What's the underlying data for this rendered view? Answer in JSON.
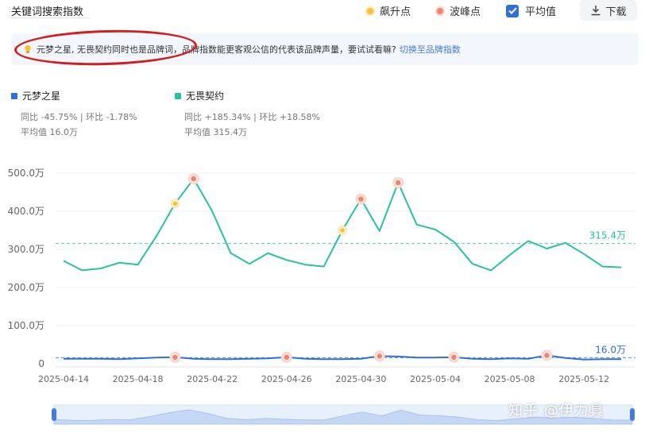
{
  "header": {
    "title": "关键词搜索指数",
    "legend_rise": "飙升点",
    "legend_peak": "波峰点",
    "avg_checkbox_label": "平均值",
    "download_label": "下载"
  },
  "notice": {
    "text": "元梦之星, 无畏契约同时也是品牌词，品牌指数能更客观公信的代表该品牌声量，要试试看嘛?",
    "link": "切换至品牌指数"
  },
  "series_info": [
    {
      "name": "元梦之星",
      "yoy": "同比 -45.75% | 环比 -1.78%",
      "avg": "平均值 16.0万",
      "color": "#2f6fd6"
    },
    {
      "name": "无畏契约",
      "yoy": "同比 +185.34% | 环比 +18.58%",
      "avg": "平均值 315.4万",
      "color": "#28c2a0"
    }
  ],
  "colors": {
    "series1": "#2f6fd6",
    "series2": "#28c2a0",
    "rise": "#f6c33e",
    "peak": "#f2826b",
    "accent": "#2f6fd6"
  },
  "watermark": "知乎 @伊力具",
  "chart_data": {
    "type": "line",
    "x": [
      "2025-04-14",
      "2025-04-15",
      "2025-04-16",
      "2025-04-17",
      "2025-04-18",
      "2025-04-19",
      "2025-04-20",
      "2025-04-21",
      "2025-04-22",
      "2025-04-23",
      "2025-04-24",
      "2025-04-25",
      "2025-04-26",
      "2025-04-27",
      "2025-04-28",
      "2025-04-29",
      "2025-04-30",
      "2025-05-01",
      "2025-05-02",
      "2025-05-03",
      "2025-05-04",
      "2025-05-05",
      "2025-05-06",
      "2025-05-07",
      "2025-05-08",
      "2025-05-09",
      "2025-05-10",
      "2025-05-11",
      "2025-05-12",
      "2025-05-13",
      "2025-05-14"
    ],
    "x_ticks": [
      "2025-04-14",
      "2025-04-18",
      "2025-04-22",
      "2025-04-26",
      "2025-04-30",
      "2025-05-04",
      "2025-05-08",
      "2025-05-12"
    ],
    "y_ticks": [
      "0",
      "100.0万",
      "200.0万",
      "300.0万",
      "400.0万",
      "500.0万"
    ],
    "ylim": [
      0,
      500
    ],
    "unit": "万",
    "series": [
      {
        "name": "元梦之星",
        "values": [
          13,
          13,
          13,
          12,
          14,
          16,
          17,
          13,
          12,
          12,
          13,
          14,
          17,
          13,
          12,
          12,
          13,
          20,
          19,
          16,
          16,
          17,
          13,
          12,
          14,
          13,
          22,
          15,
          11,
          12,
          12
        ],
        "average": 16.0,
        "average_label": "16.0万",
        "rise_points": [],
        "peak_points": [
          6,
          12,
          17,
          21,
          26
        ]
      },
      {
        "name": "无畏契约",
        "values": [
          270,
          245,
          250,
          265,
          260,
          335,
          420,
          485,
          400,
          290,
          262,
          290,
          272,
          260,
          255,
          350,
          432,
          348,
          475,
          365,
          352,
          320,
          262,
          245,
          285,
          322,
          302,
          317,
          288,
          255,
          253
        ],
        "average": 315.4,
        "average_label": "315.4万",
        "rise_points": [
          6,
          15
        ],
        "peak_points": [
          7,
          16,
          18
        ]
      }
    ],
    "grid": true,
    "legend": "top-left"
  }
}
